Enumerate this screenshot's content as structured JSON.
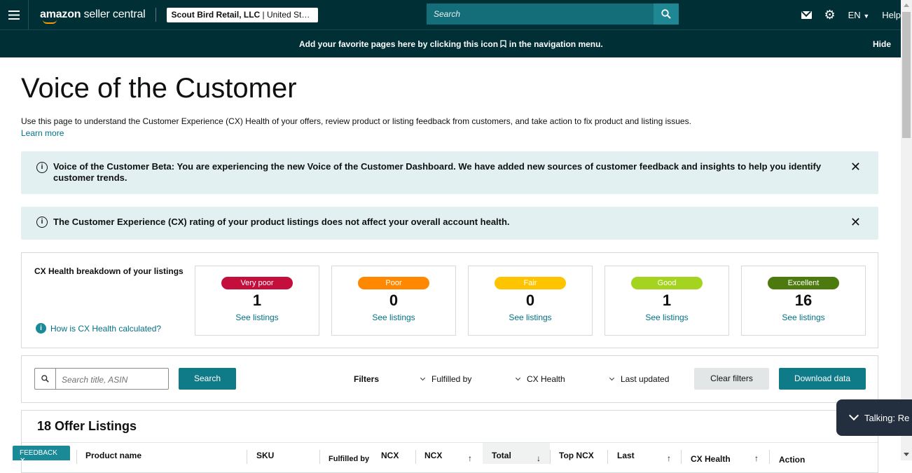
{
  "header": {
    "logo_bold": "amazon",
    "logo_light": " seller central",
    "account_name": "Scout Bird Retail, LLC",
    "account_region": " | United St…",
    "search_placeholder": "Search",
    "language": "EN",
    "help": "Help"
  },
  "favorites_bar": {
    "message_before": "Add your favorite pages here by clicking this icon",
    "message_after": "in the navigation menu.",
    "hide": "Hide"
  },
  "page": {
    "title": "Voice of the Customer",
    "intro": "Use this page to understand the Customer Experience (CX) Health of your offers, review product or listing feedback from customers, and take action to fix product and listing issues.",
    "learn_more": "Learn more"
  },
  "alerts": [
    {
      "text": "Voice of the Customer Beta: You are experiencing the new Voice of the Customer Dashboard. We have added new sources of customer feedback and insights to help you identify customer trends."
    },
    {
      "text": "The Customer Experience (CX) rating of your product listings does not affect your overall account health."
    }
  ],
  "cx_health": {
    "title": "CX Health breakdown of your listings",
    "how_link": "How is CX Health calculated?",
    "see_listings": "See listings",
    "cards": [
      {
        "label": "Very poor",
        "count": "1",
        "color": "#c40e3b"
      },
      {
        "label": "Poor",
        "count": "0",
        "color": "#ff8800"
      },
      {
        "label": "Fair",
        "count": "0",
        "color": "#ffc400"
      },
      {
        "label": "Good",
        "count": "1",
        "color": "#a4d41f"
      },
      {
        "label": "Excellent",
        "count": "16",
        "color": "#4d7a0f"
      }
    ]
  },
  "filters": {
    "search_placeholder": "Search title, ASIN",
    "search_button": "Search",
    "filters_label": "Filters",
    "fulfilled_by": "Fulfilled by",
    "cx_health": "CX Health",
    "last_updated": "Last updated",
    "clear_filters": "Clear filters",
    "download_data": "Download data"
  },
  "listings": {
    "title": "18 Offer Listings",
    "columns": [
      "Product name",
      "SKU",
      "Fulfilled by",
      "NCX",
      "NCX",
      "Total",
      "Top NCX",
      "Last",
      "CX Health",
      "Action"
    ]
  },
  "feedback_button": "FEEDBACK",
  "talking_widget": "Talking: Re"
}
